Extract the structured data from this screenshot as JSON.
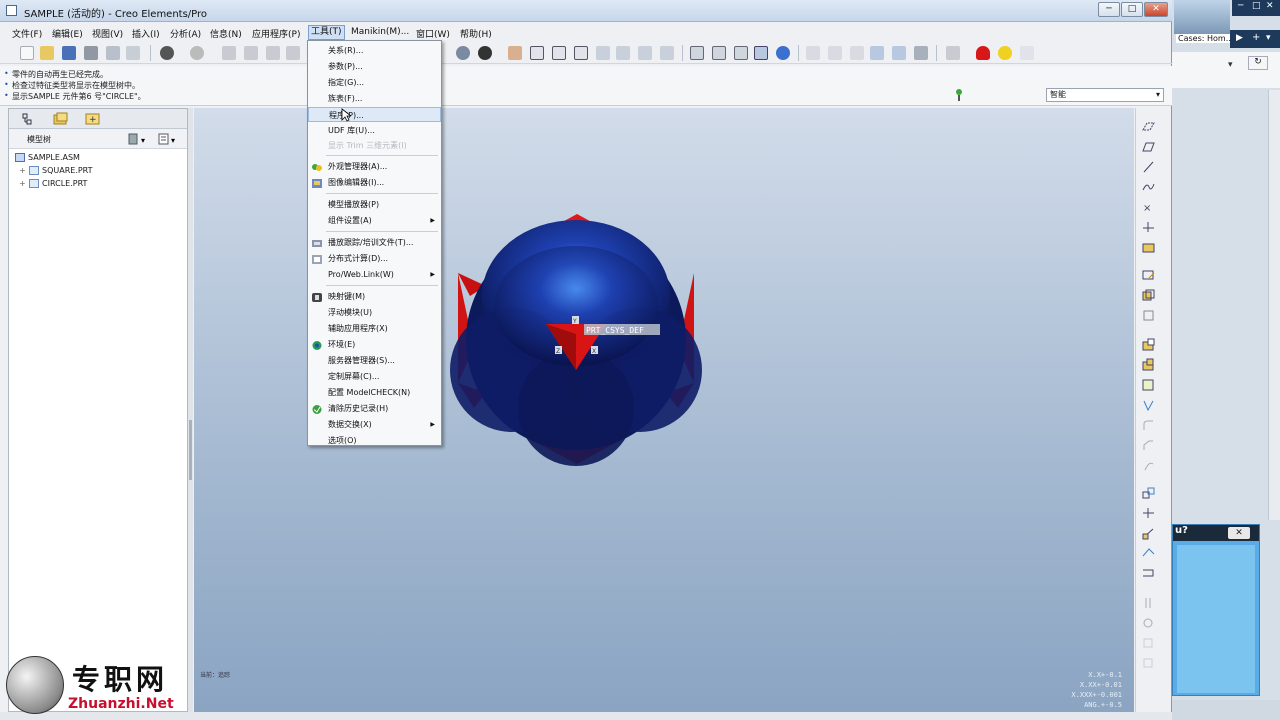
{
  "window": {
    "title": "SAMPLE (活动的) - Creo Elements/Pro",
    "min_label": "─",
    "max_label": "□",
    "close_label": "✕"
  },
  "menubar": [
    "文件(F)",
    "编辑(E)",
    "视图(V)",
    "插入(I)",
    "分析(A)",
    "信息(N)",
    "应用程序(P)",
    "工具(T)",
    "Manikin(M)...",
    "窗口(W)",
    "帮助(H)"
  ],
  "messages": [
    "零件的自动再生已经完成。",
    "检查过特征类型将显示在模型树中。",
    "显示SAMPLE 元件第6 号\"CIRCLE\"。"
  ],
  "filter": {
    "value": "智能"
  },
  "navigator": {
    "header_label": "模型树",
    "items": [
      {
        "label": "SAMPLE.ASM",
        "level": 0
      },
      {
        "label": "SQUARE.PRT",
        "level": 1
      },
      {
        "label": "CIRCLE.PRT",
        "level": 1
      }
    ]
  },
  "tools_menu": {
    "items": [
      {
        "label": "关系(R)...",
        "icon": "",
        "submenu": false,
        "disabled": false
      },
      {
        "label": "参数(P)...",
        "icon": "",
        "submenu": false,
        "disabled": false
      },
      {
        "label": "指定(G)...",
        "icon": "",
        "submenu": false,
        "disabled": false
      },
      {
        "label": "族表(F)...",
        "icon": "",
        "submenu": false,
        "disabled": false
      },
      {
        "label": "程序(P)...",
        "icon": "",
        "submenu": false,
        "disabled": false,
        "highlight": true
      },
      {
        "label": "UDF 库(U)...",
        "icon": "",
        "submenu": false,
        "disabled": false
      },
      {
        "label": "显示 Trim 三维元素(I)",
        "icon": "",
        "submenu": false,
        "disabled": true
      },
      {
        "sep": true
      },
      {
        "label": "外观管理器(A)...",
        "icon": "appearance-icon",
        "submenu": false,
        "disabled": false
      },
      {
        "label": "图像编辑器(I)...",
        "icon": "image-editor-icon",
        "submenu": false,
        "disabled": false
      },
      {
        "sep": true
      },
      {
        "label": "模型播放器(P)",
        "icon": "",
        "submenu": false,
        "disabled": false
      },
      {
        "label": "组件设置(A)",
        "icon": "",
        "submenu": true,
        "disabled": false
      },
      {
        "sep": true
      },
      {
        "label": "播放跟踪/培训文件(T)...",
        "icon": "trail-icon",
        "submenu": false,
        "disabled": false
      },
      {
        "label": "分布式计算(D)...",
        "icon": "distributed-icon",
        "submenu": false,
        "disabled": false
      },
      {
        "label": "Pro/Web.Link(W)",
        "icon": "",
        "submenu": true,
        "disabled": false
      },
      {
        "sep": true
      },
      {
        "label": "映射键(M)",
        "icon": "mapkey-icon",
        "submenu": false,
        "disabled": false
      },
      {
        "label": "浮动模块(U)",
        "icon": "",
        "submenu": false,
        "disabled": false
      },
      {
        "label": "辅助应用程序(X)",
        "icon": "",
        "submenu": false,
        "disabled": false
      },
      {
        "label": "环境(E)",
        "icon": "environment-icon",
        "submenu": false,
        "disabled": false
      },
      {
        "label": "服务器管理器(S)...",
        "icon": "",
        "submenu": false,
        "disabled": false
      },
      {
        "label": "定制屏幕(C)...",
        "icon": "",
        "submenu": false,
        "disabled": false
      },
      {
        "label": "配置 ModelCHECK(N)",
        "icon": "",
        "submenu": false,
        "disabled": false
      },
      {
        "label": "清除历史记录(H)",
        "icon": "clear-history-icon",
        "submenu": false,
        "disabled": false
      },
      {
        "label": "数据交换(X)",
        "icon": "",
        "submenu": true,
        "disabled": false
      },
      {
        "label": "选项(O)",
        "icon": "",
        "submenu": false,
        "disabled": false
      }
    ]
  },
  "graphics": {
    "csys_label": "PRT_CSYS_DEF",
    "axis_labels": [
      "Y",
      "Z",
      "X"
    ],
    "note": "当前：追踪",
    "coords": [
      "X.X+-0.1",
      "X.XX+-0.01",
      "X.XXX+-0.001",
      "ANG.+-0.5"
    ]
  },
  "background_window": {
    "tab_label": "Cases: Hom...",
    "dialog_title": "u?",
    "dialog_close": "✕"
  },
  "watermark": {
    "cn": "专职网",
    "en": "Zhuanzhi.Net"
  },
  "colors": {
    "sphere": "#1b2a8a",
    "red_part": "#e01818",
    "bg_top": "#d2dcea",
    "bg_bottom": "#8aa4c2"
  }
}
